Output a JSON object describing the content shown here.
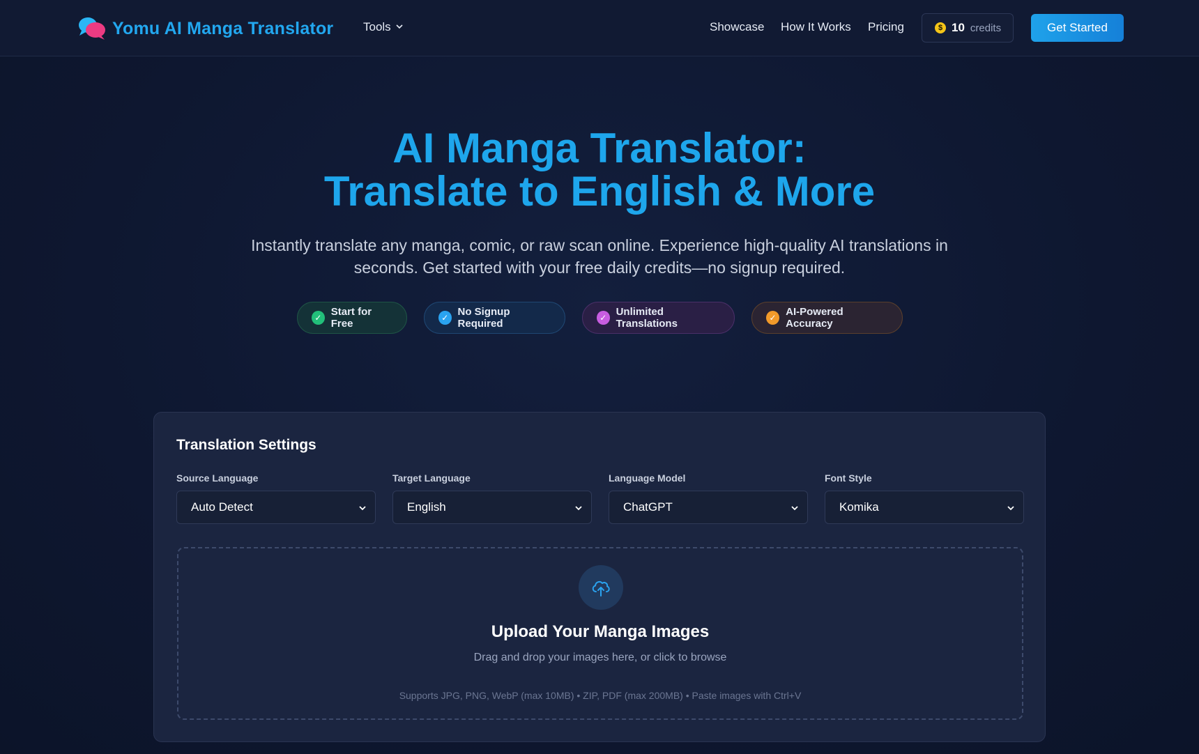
{
  "header": {
    "brand": "Yomu AI Manga Translator",
    "tools_label": "Tools",
    "nav": [
      "Showcase",
      "How It Works",
      "Pricing"
    ],
    "credits_count": "10",
    "credits_label": "credits",
    "cta": "Get Started"
  },
  "hero": {
    "title_line1": "AI Manga Translator:",
    "title_line2": "Translate to English & More",
    "subtitle_line1": "Instantly translate any manga, comic, or raw scan online. Experience high-quality AI translations in",
    "subtitle_line2": "seconds. Get started with your free daily credits—no signup required.",
    "badges": [
      {
        "label": "Start for Free",
        "color": "#22c07a"
      },
      {
        "label": "No Signup Required",
        "color": "#2aa3f0"
      },
      {
        "label": "Unlimited Translations",
        "color": "#c85de0"
      },
      {
        "label": "AI-Powered Accuracy",
        "color": "#f29a2a"
      }
    ]
  },
  "settings": {
    "title": "Translation Settings",
    "fields": [
      {
        "label": "Source Language",
        "value": "Auto Detect"
      },
      {
        "label": "Target Language",
        "value": "English"
      },
      {
        "label": "Language Model",
        "value": "ChatGPT"
      },
      {
        "label": "Font Style",
        "value": "Komika"
      }
    ]
  },
  "upload": {
    "title": "Upload Your Manga Images",
    "description": "Drag and drop your images here, or click to browse",
    "support": "Supports JPG, PNG, WebP (max 10MB) • ZIP, PDF (max 200MB) • Paste images with Ctrl+V"
  },
  "colors": {
    "accent": "#1ea6ec",
    "background": "#0f1830",
    "card": "#1b2540"
  }
}
